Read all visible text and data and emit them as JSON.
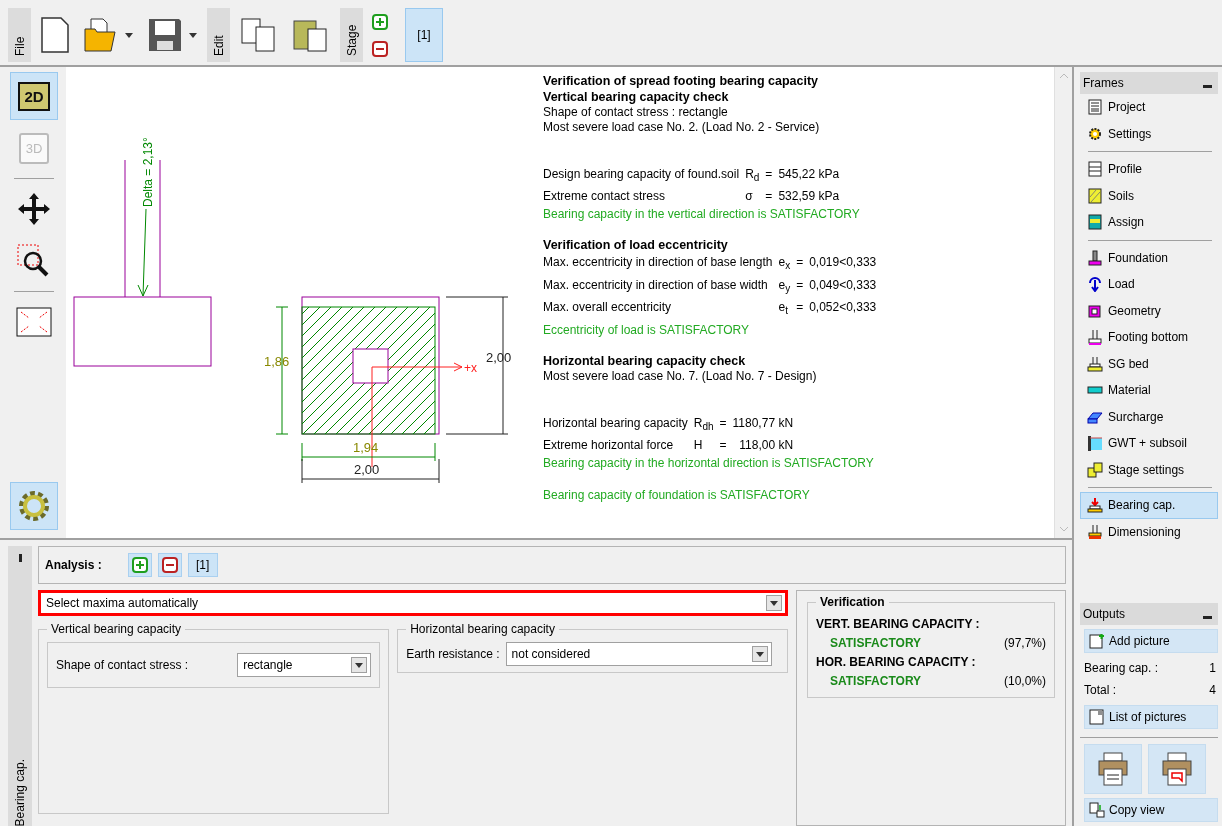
{
  "toolbar": {
    "groups": [
      {
        "label": "File",
        "buttons": [
          {
            "kind": "new",
            "menu": false
          },
          {
            "kind": "open",
            "menu": true
          },
          {
            "kind": "save",
            "menu": true
          }
        ]
      },
      {
        "label": "Edit",
        "buttons": [
          {
            "kind": "copy",
            "menu": false
          },
          {
            "kind": "paste",
            "menu": false
          }
        ]
      },
      {
        "label": "Stage",
        "buttons": [
          {
            "kind": "add",
            "menu": false
          },
          {
            "kind": "remove",
            "menu": false
          }
        ],
        "stages": [
          {
            "label": "[1]",
            "selected": true
          }
        ]
      }
    ]
  },
  "view_tools": [
    {
      "items": [
        {
          "kind": "flat",
          "label": "2D",
          "selected": true,
          "disabled": false
        },
        {
          "kind": "cube",
          "label": "3D",
          "selected": false,
          "disabled": true
        }
      ]
    },
    {
      "items": [
        {
          "kind": "move",
          "selected": false,
          "disabled": false
        },
        {
          "kind": "zoom",
          "selected": false,
          "disabled": false
        }
      ]
    },
    {
      "items": [
        {
          "kind": "fit",
          "selected": false,
          "disabled": false
        }
      ]
    }
  ],
  "settings_button": {
    "selected": true
  },
  "drawing": {
    "load_label": "Delta = 2,13°",
    "axis_label": "+x",
    "height_inner": "1,86",
    "height_outer": "2,00",
    "width_inner": "1,94",
    "width_outer": "2,00"
  },
  "report": [
    {
      "kind": "heading",
      "text": "Verification of spread footing bearing capacity"
    },
    {
      "kind": "heading",
      "text": "Vertical bearing capacity check"
    },
    {
      "kind": "text",
      "text": "Shape of contact stress : rectangle"
    },
    {
      "kind": "text",
      "text": "Most severe load case No. 2. (Load No. 2 - Service)"
    },
    {
      "kind": "formulas",
      "rows": [
        {
          "label": "Design bearing capacity of found.soil",
          "symbol": "R$_{d}$",
          "relation": "=",
          "value": "545,22 kPa"
        },
        {
          "label": "Extreme contact stress",
          "symbol": "σ",
          "relation": "=",
          "value": "532,59 kPa"
        }
      ]
    },
    {
      "kind": "ok",
      "text": "Bearing capacity in the vertical direction is SATISFACTORY"
    },
    {
      "kind": "heading",
      "text": "Verification of load eccentricity"
    },
    {
      "kind": "formulas",
      "rows": [
        {
          "label": "Max. eccentricity in direction of base length",
          "symbol": "e$_{x}$",
          "relation": "=",
          "value": "0,019<0,333"
        },
        {
          "label": "Max. eccentricity in direction of base width",
          "symbol": "e$_{y}$",
          "relation": "=",
          "value": "0,049<0,333"
        },
        {
          "label": "Max. overall eccentricity",
          "symbol": "e$_{t}$",
          "relation": "=",
          "value": "0,052<0,333"
        }
      ]
    },
    {
      "kind": "ok",
      "text": "Eccentricity of load is SATISFACTORY"
    },
    {
      "kind": "heading",
      "text": "Horizontal bearing capacity check"
    },
    {
      "kind": "text",
      "text": "Most severe load case No. 7. (Load No. 7 - Design)"
    },
    {
      "kind": "formulas",
      "rows": [
        {
          "label": "Horizontal bearing capacity",
          "symbol": "R$_{dh}$",
          "relation": "=",
          "value": "1180,77 kN"
        },
        {
          "label": "Extreme horizontal force",
          "symbol": "H",
          "relation": "=",
          "value": "118,00 kN"
        }
      ]
    },
    {
      "kind": "ok",
      "text": "Bearing capacity in the horizontal direction is SATISFACTORY"
    },
    {
      "kind": "ok",
      "text": "Bearing capacity of foundation is SATISFACTORY"
    }
  ],
  "frames": {
    "title": "Frames",
    "groups": [
      {
        "items": [
          {
            "label": "Project",
            "selected": false
          },
          {
            "label": "Settings",
            "selected": false
          }
        ]
      },
      {
        "items": [
          {
            "label": "Profile",
            "selected": false
          },
          {
            "label": "Soils",
            "selected": false
          },
          {
            "label": "Assign",
            "selected": false
          }
        ]
      },
      {
        "items": [
          {
            "label": "Foundation",
            "selected": false
          },
          {
            "label": "Load",
            "selected": false
          },
          {
            "label": "Geometry",
            "selected": false
          },
          {
            "label": "Footing bottom",
            "selected": false
          },
          {
            "label": "SG bed",
            "selected": false
          },
          {
            "label": "Material",
            "selected": false
          },
          {
            "label": "Surcharge",
            "selected": false
          },
          {
            "label": "GWT + subsoil",
            "selected": false
          },
          {
            "label": "Stage settings",
            "selected": false
          }
        ]
      },
      {
        "items": [
          {
            "label": "Bearing cap.",
            "selected": true
          },
          {
            "label": "Dimensioning",
            "selected": false
          }
        ]
      }
    ]
  },
  "bottom_panel": {
    "tab": "Bearing cap.",
    "analysis": {
      "label": "Analysis :",
      "stages": [
        {
          "label": "[1]",
          "selected": true
        }
      ]
    },
    "mode_select": {
      "value": "Select maxima automatically",
      "highlighted": true
    },
    "vertical": {
      "title": "Vertical bearing capacity",
      "field_label": "Shape of contact stress :",
      "value": "rectangle"
    },
    "horizontal": {
      "title": "Horizontal bearing capacity",
      "field_label": "Earth resistance :",
      "value": "not considered"
    },
    "verification": {
      "title": "Verification",
      "items": [
        {
          "heading": "VERT. BEARING CAPACITY :",
          "status": "SATISFACTORY",
          "percent": "(97,7%)"
        },
        {
          "heading": "HOR. BEARING CAPACITY :",
          "status": "SATISFACTORY",
          "percent": "(10,0%)"
        }
      ]
    }
  },
  "outputs": {
    "title": "Outputs",
    "add_button": "Add picture",
    "counts": [
      {
        "label": "Bearing cap. :",
        "value": "1"
      },
      {
        "label": "Total :",
        "value": "4"
      }
    ],
    "list_button": "List of pictures",
    "copy_button": "Copy view"
  }
}
